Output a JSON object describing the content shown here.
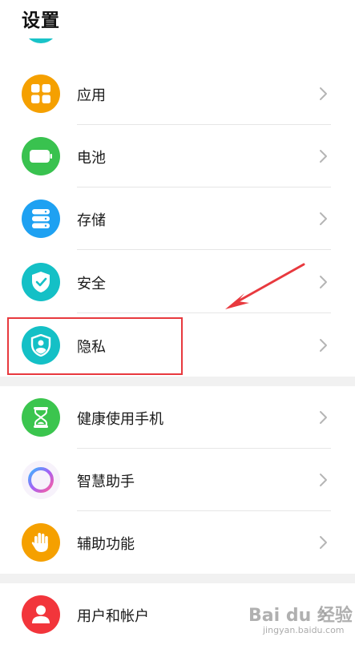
{
  "header": {
    "title": "设置"
  },
  "groups": [
    {
      "items": [
        {
          "label": "应用",
          "icon": "apps-icon",
          "color": "#f5a000"
        },
        {
          "label": "电池",
          "icon": "battery-icon",
          "color": "#39c24f"
        },
        {
          "label": "存储",
          "icon": "storage-icon",
          "color": "#1ea1f2"
        },
        {
          "label": "安全",
          "icon": "security-shield-icon",
          "color": "#14c0c6"
        },
        {
          "label": "隐私",
          "icon": "privacy-icon",
          "color": "#14c0c6"
        }
      ]
    },
    {
      "items": [
        {
          "label": "健康使用手机",
          "icon": "hourglass-icon",
          "color": "#3bc54e"
        },
        {
          "label": "智慧助手",
          "icon": "assistant-ring-icon",
          "color": "#9b6cf5"
        },
        {
          "label": "辅助功能",
          "icon": "hand-icon",
          "color": "#f5a000"
        }
      ]
    },
    {
      "items": [
        {
          "label": "用户和帐户",
          "icon": "user-icon",
          "color": "#f2353b"
        }
      ]
    }
  ],
  "annotation": {
    "highlight_color": "#e8393e"
  },
  "watermark": {
    "main": "Bai du 经验",
    "sub": "jingyan.baidu.com"
  }
}
